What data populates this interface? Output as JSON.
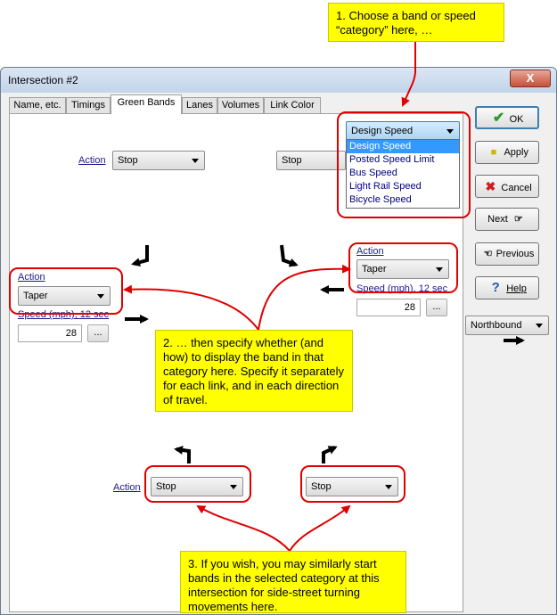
{
  "callouts": {
    "one": "1. Choose a band or speed “category” here, …",
    "two": "2. … then specify whether (and how) to display the band in that category here. Specify it separately for each link, and in each direction of travel.",
    "three": "3. If you wish, you may similarly start bands in the selected category at this intersection for side-street turning movements here."
  },
  "window": {
    "title": "Intersection #2",
    "close": "X"
  },
  "tabs": [
    "Name, etc.",
    "Timings",
    "Green Bands",
    "Lanes",
    "Volumes",
    "Link Color"
  ],
  "category": {
    "selected": "Design Speed",
    "options": [
      "Design Speed",
      "Posted Speed Limit",
      "Bus Speed",
      "Light Rail Speed",
      "Bicycle Speed"
    ]
  },
  "action_label": "Action",
  "speed_label": "Speed (mph), 12 sec",
  "top_left": {
    "value": "Stop"
  },
  "top_right": {
    "value": "Stop"
  },
  "left": {
    "value": "Taper",
    "speed": "28",
    "ellipsis": "..."
  },
  "right": {
    "value": "Taper",
    "speed": "28",
    "ellipsis": "..."
  },
  "bottom_left": {
    "value": "Stop"
  },
  "bottom_right": {
    "value": "Stop"
  },
  "buttons": {
    "ok": "OK",
    "apply": "Apply",
    "cancel": "Cancel",
    "next": "Next",
    "previous": "Previous",
    "help": "Help"
  },
  "direction": {
    "value": "Northbound"
  },
  "colors": {
    "callout": "#ffff00",
    "highlight": "#e00000",
    "selection": "#3399ff"
  }
}
